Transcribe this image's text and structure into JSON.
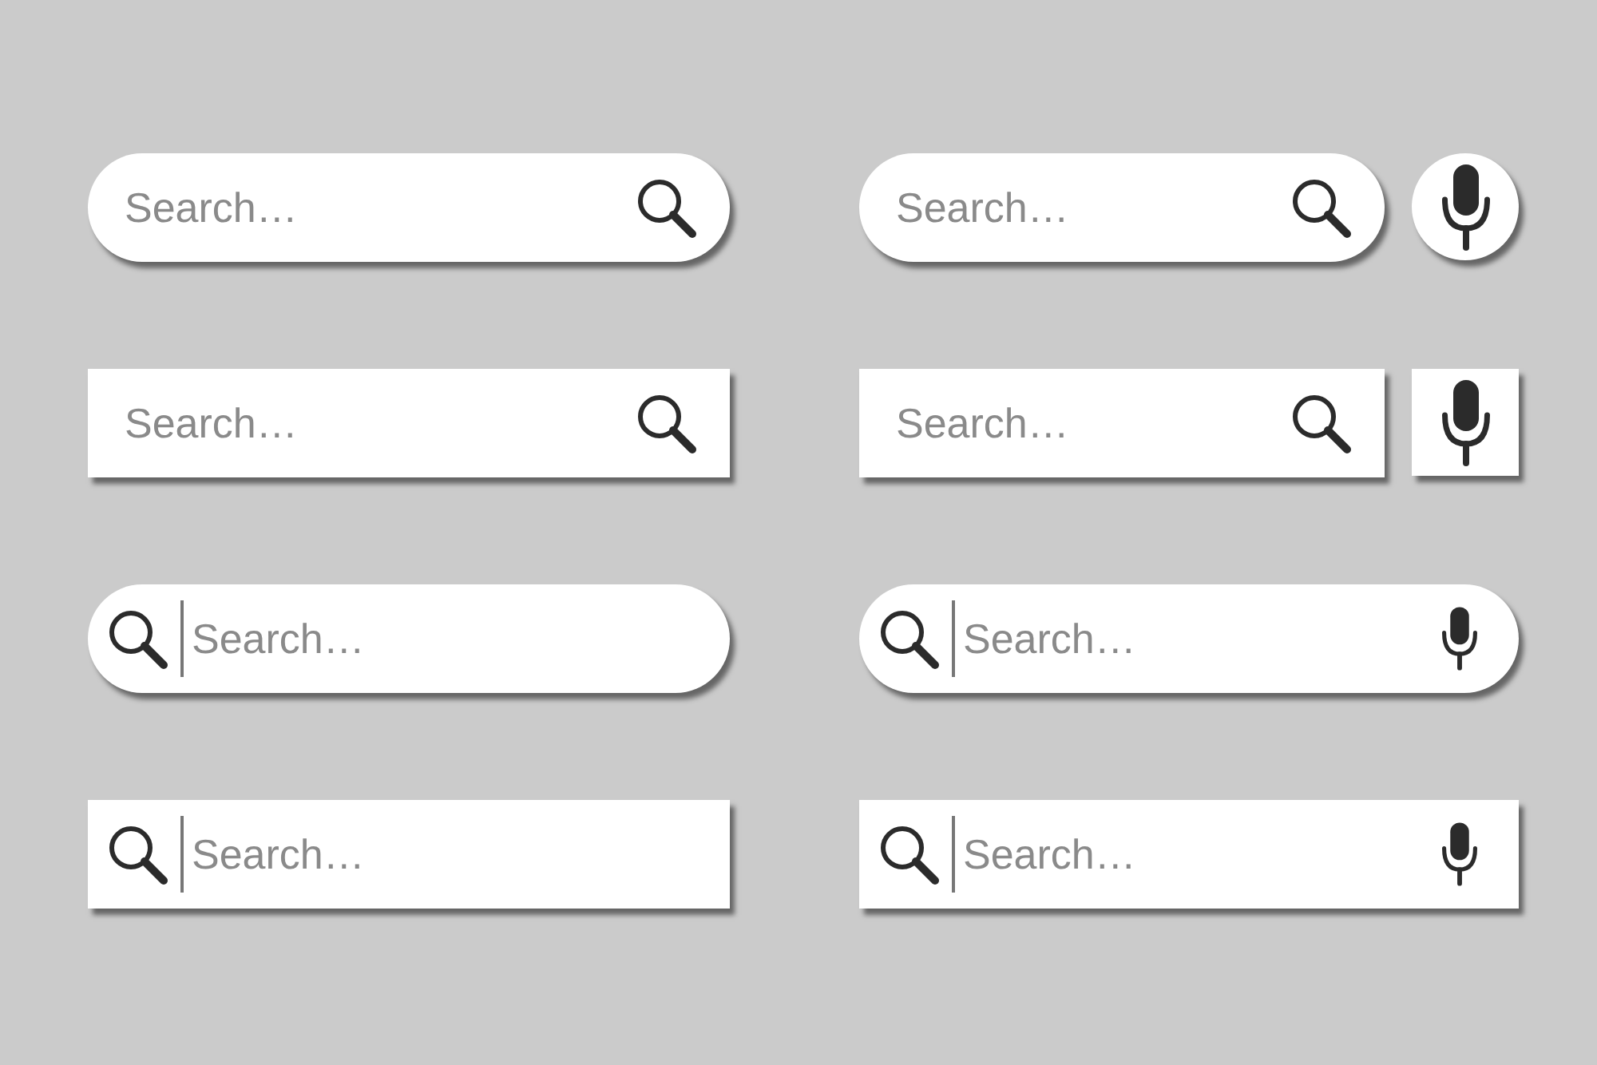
{
  "search_bars": [
    {
      "kind": "icon-right",
      "rounded": true,
      "mic_button": false,
      "mic_inline": false,
      "placeholder": "Search…"
    },
    {
      "kind": "icon-right",
      "rounded": true,
      "mic_button": true,
      "mic_inline": false,
      "placeholder": "Search…"
    },
    {
      "kind": "icon-right",
      "rounded": false,
      "mic_button": false,
      "mic_inline": false,
      "placeholder": "Search…"
    },
    {
      "kind": "icon-right",
      "rounded": false,
      "mic_button": true,
      "mic_inline": false,
      "placeholder": "Search…"
    },
    {
      "kind": "icon-left",
      "rounded": true,
      "mic_button": false,
      "mic_inline": false,
      "placeholder": "Search…"
    },
    {
      "kind": "icon-left",
      "rounded": true,
      "mic_button": false,
      "mic_inline": true,
      "placeholder": "Search…"
    },
    {
      "kind": "icon-left",
      "rounded": false,
      "mic_button": false,
      "mic_inline": false,
      "placeholder": "Search…"
    },
    {
      "kind": "icon-left",
      "rounded": false,
      "mic_button": false,
      "mic_inline": true,
      "placeholder": "Search…"
    }
  ]
}
